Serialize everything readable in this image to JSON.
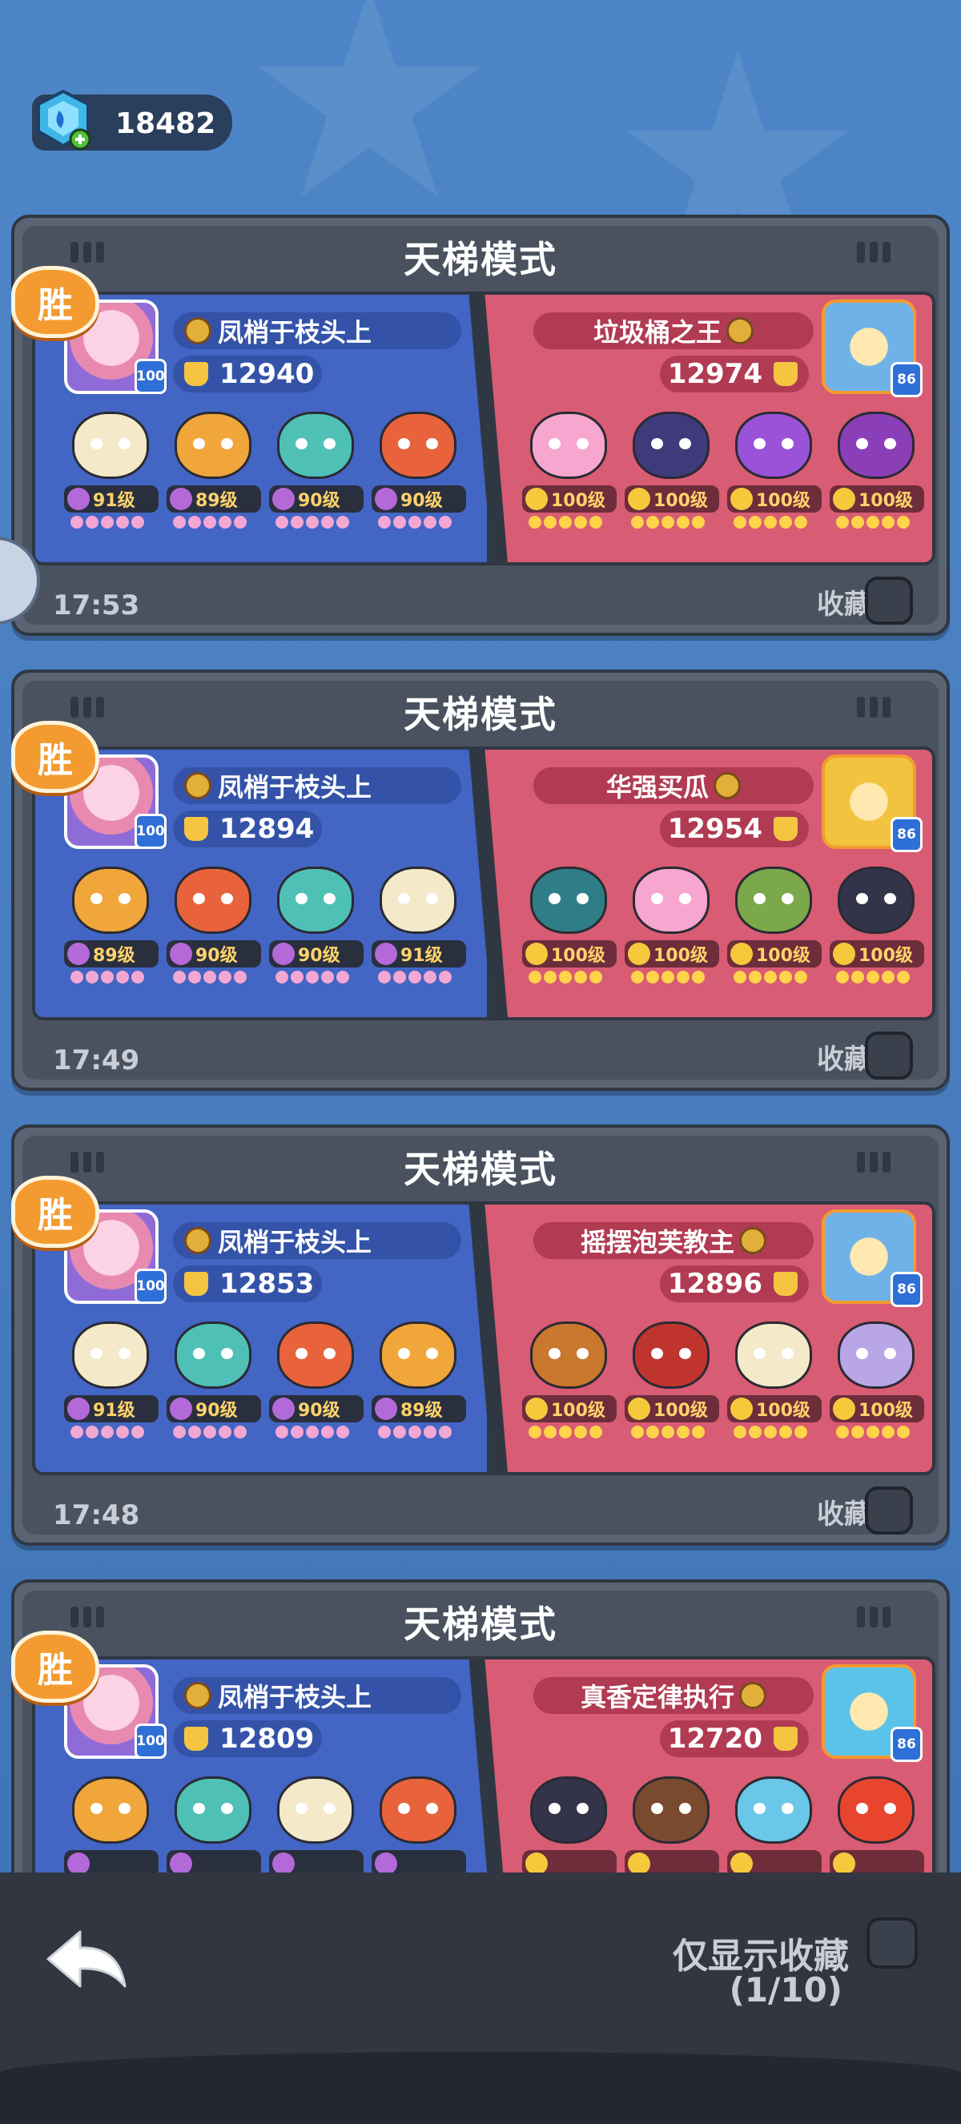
{
  "currency": {
    "amount": "18482",
    "icon": "gem-plus-icon"
  },
  "labels": {
    "win": "胜",
    "favorite": "收藏"
  },
  "footer": {
    "show_favorites_only": "仅显示收藏",
    "count": "(1/10)",
    "back_icon": "back-arrow-icon"
  },
  "matches": [
    {
      "mode": "天梯模式",
      "time": "17:53",
      "left": {
        "name": "凤梢于枝头上",
        "score": "12940",
        "level": "100",
        "heroes": [
          {
            "level": "91级",
            "color": "#f4e9c9",
            "stars": "purple"
          },
          {
            "level": "89级",
            "color": "#f0a63a",
            "stars": "purple"
          },
          {
            "level": "90级",
            "color": "#4fc0b6",
            "stars": "purple"
          },
          {
            "level": "90级",
            "color": "#e8633b",
            "stars": "purple"
          }
        ]
      },
      "right": {
        "name": "垃圾桶之王",
        "score": "12974",
        "level": "86",
        "avatar_color": "#6fb2e8",
        "heroes": [
          {
            "level": "100级",
            "color": "#f7a7cf",
            "stars": "gold"
          },
          {
            "level": "100级",
            "color": "#3f3a7a",
            "stars": "gold"
          },
          {
            "level": "100级",
            "color": "#9a52d8",
            "stars": "gold"
          },
          {
            "level": "100级",
            "color": "#8a3fb8",
            "stars": "gold"
          }
        ]
      }
    },
    {
      "mode": "天梯模式",
      "time": "17:49",
      "left": {
        "name": "凤梢于枝头上",
        "score": "12894",
        "level": "100",
        "heroes": [
          {
            "level": "89级",
            "color": "#f0a63a",
            "stars": "purple"
          },
          {
            "level": "90级",
            "color": "#e8633b",
            "stars": "purple"
          },
          {
            "level": "90级",
            "color": "#4fc0b6",
            "stars": "purple"
          },
          {
            "level": "91级",
            "color": "#f4e9c9",
            "stars": "purple"
          }
        ]
      },
      "right": {
        "name": "华强买瓜",
        "score": "12954",
        "level": "86",
        "avatar_color": "#f2c33e",
        "heroes": [
          {
            "level": "100级",
            "color": "#2f7d86",
            "stars": "gold"
          },
          {
            "level": "100级",
            "color": "#f7a7cf",
            "stars": "gold"
          },
          {
            "level": "100级",
            "color": "#7ba84a",
            "stars": "gold"
          },
          {
            "level": "100级",
            "color": "#33334a",
            "stars": "gold"
          }
        ]
      }
    },
    {
      "mode": "天梯模式",
      "time": "17:48",
      "left": {
        "name": "凤梢于枝头上",
        "score": "12853",
        "level": "100",
        "heroes": [
          {
            "level": "91级",
            "color": "#f4e9c9",
            "stars": "purple"
          },
          {
            "level": "90级",
            "color": "#4fc0b6",
            "stars": "purple"
          },
          {
            "level": "90级",
            "color": "#e8633b",
            "stars": "purple"
          },
          {
            "level": "89级",
            "color": "#f0a63a",
            "stars": "purple"
          }
        ]
      },
      "right": {
        "name": "摇摆泡芙教主",
        "score": "12896",
        "level": "86",
        "avatar_color": "#6fb2e8",
        "heroes": [
          {
            "level": "100级",
            "color": "#c9782d",
            "stars": "gold"
          },
          {
            "level": "100级",
            "color": "#c0342e",
            "stars": "gold"
          },
          {
            "level": "100级",
            "color": "#f4e9c9",
            "stars": "gold"
          },
          {
            "level": "100级",
            "color": "#b9a6e6",
            "stars": "gold"
          }
        ]
      }
    },
    {
      "mode": "天梯模式",
      "time": "",
      "left": {
        "name": "凤梢于枝头上",
        "score": "12809",
        "level": "100",
        "heroes": [
          {
            "level": "",
            "color": "#f0a63a",
            "stars": "purple"
          },
          {
            "level": "",
            "color": "#4fc0b6",
            "stars": "purple"
          },
          {
            "level": "",
            "color": "#f4e9c9",
            "stars": "purple"
          },
          {
            "level": "",
            "color": "#e8633b",
            "stars": "purple"
          }
        ]
      },
      "right": {
        "name": "真香定律执行",
        "score": "12720",
        "level": "86",
        "avatar_color": "#5bc3ea",
        "heroes": [
          {
            "level": "",
            "color": "#33334a",
            "stars": "gold"
          },
          {
            "level": "",
            "color": "#7a4a2e",
            "stars": "gold"
          },
          {
            "level": "",
            "color": "#6ac7e8",
            "stars": "gold"
          },
          {
            "level": "",
            "color": "#e8452e",
            "stars": "gold"
          }
        ]
      }
    }
  ]
}
